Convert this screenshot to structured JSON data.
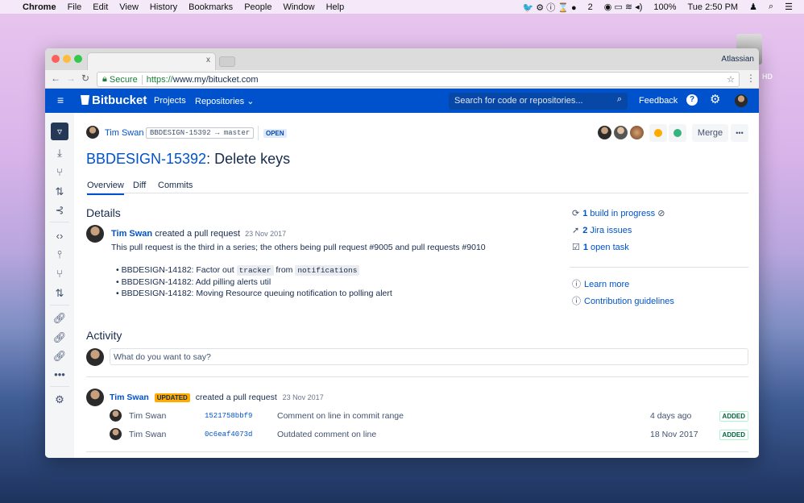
{
  "menubar": {
    "app": "Chrome",
    "items": [
      "File",
      "Edit",
      "View",
      "History",
      "Bookmarks",
      "People",
      "Window",
      "Help"
    ],
    "badge_count": "2",
    "battery": "100%",
    "clock": "Tue 2:50 PM"
  },
  "desktop": {
    "drive_label": "HD"
  },
  "browser": {
    "profile": "Atlassian",
    "close_tab": "x",
    "secure_label": "Secure",
    "url_scheme": "https://",
    "url_host": "www.my/bitucket.com"
  },
  "nav": {
    "brand": "Bitbucket",
    "projects": "Projects",
    "repositories": "Repositories",
    "search_placeholder": "Search for code or repositories...",
    "feedback": "Feedback",
    "help": "?"
  },
  "pr": {
    "author": "Tim Swan",
    "source_branch": "BBDESIGN-15392",
    "target_branch": "master",
    "status": "OPEN",
    "key": "BBDESIGN-15392",
    "title": ": Delete keys",
    "merge": "Merge",
    "more": "•••"
  },
  "tabs": [
    "Overview",
    "Diff",
    "Commits"
  ],
  "details": {
    "heading": "Details",
    "author": "Tim Swan",
    "action": "created a pull request",
    "date": "23 Nov 2017",
    "description": "This pull request is the third in a series; the others being pull request #9005 and pull requests #9010",
    "bullets": [
      {
        "text": "BBDESIGN-14182: Factor out ",
        "code1": "tracker",
        "mid": " from ",
        "code2": "notifications"
      },
      {
        "text": "BBDESIGN-14182: Add pilling alerts util"
      },
      {
        "text": "BBDESIGN-14182: Moving Resource queuing notification to polling alert"
      }
    ]
  },
  "sidebar_right": {
    "builds_count": "1",
    "builds_label": " build in progress",
    "jira_count": "2",
    "jira_label": " Jira issues",
    "tasks_count": "1",
    "tasks_label": " open task",
    "learn_more": "Learn more",
    "guidelines": "Contribution guidelines"
  },
  "activity": {
    "heading": "Activity",
    "comment_placeholder": "What do you want to say?",
    "author": "Tim Swan",
    "badge": "UPDATED",
    "action": "created a pull request",
    "date": "23 Nov 2017",
    "rows": [
      {
        "author": "Tim Swan",
        "hash": "1521758bbf9",
        "message": "Comment on line in commit range",
        "time": "4 days ago",
        "status": "ADDED"
      },
      {
        "author": "Tim Swan",
        "hash": "0c6eaf4073d",
        "message": "Outdated comment on line",
        "time": "18 Nov 2017",
        "status": "ADDED"
      }
    ]
  }
}
